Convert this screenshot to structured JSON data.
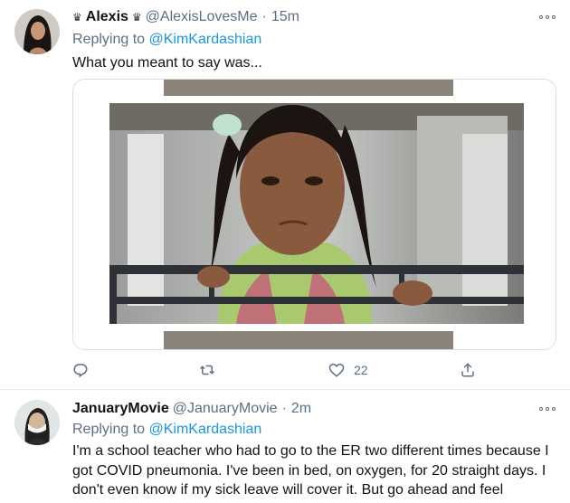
{
  "tweets": [
    {
      "display_name": "Alexis",
      "crown_left": "♛",
      "crown_right": "♛",
      "handle": "@AlexisLovesMe",
      "separator": "·",
      "time": "15m",
      "replying_prefix": "Replying to",
      "replying_to": "@KimKardashian",
      "text": "What you meant to say was...",
      "like_count": "22",
      "avatar_icon": "avatar-woman-dark-hair",
      "has_media": true,
      "media_description_icon": "girl-at-balcony-photo"
    },
    {
      "display_name": "JanuaryMovie",
      "handle": "@JanuaryMovie",
      "separator": "·",
      "time": "2m",
      "replying_prefix": "Replying to",
      "replying_to": "@KimKardashian",
      "text": "I'm a school teacher who had to go to the ER two different times because I got COVID pneumonia. I've been in bed, on oxygen, for 20 straight days. I don't even know if my sick leave will cover it. But go ahead and feel blessed.",
      "avatar_icon": "avatar-masked-person"
    }
  ],
  "colors": {
    "text": "#0f1419",
    "secondary": "#5b7083",
    "link": "#1b95e0",
    "border": "#e6ecf0"
  }
}
